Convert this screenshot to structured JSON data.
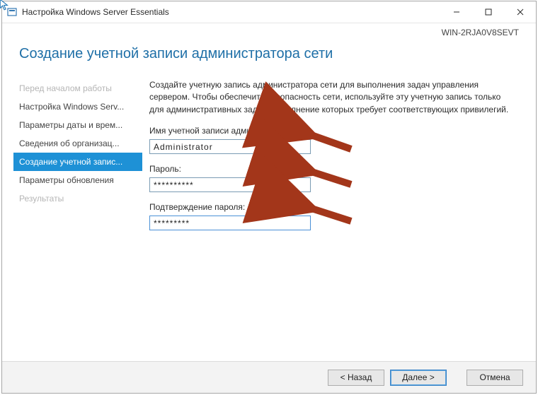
{
  "titlebar": {
    "title": "Настройка Windows Server Essentials"
  },
  "header": {
    "server_name": "WIN-2RJA0V8SEVT",
    "page_title": "Создание учетной записи администратора сети"
  },
  "sidebar": {
    "items": [
      {
        "label": "Перед началом работы",
        "state": "disabled"
      },
      {
        "label": "Настройка Windows Serv...",
        "state": "normal"
      },
      {
        "label": "Параметры даты и врем...",
        "state": "normal"
      },
      {
        "label": "Сведения об организац...",
        "state": "normal"
      },
      {
        "label": "Создание учетной запис...",
        "state": "selected"
      },
      {
        "label": "Параметры обновления",
        "state": "normal"
      },
      {
        "label": "Результаты",
        "state": "disabled"
      }
    ]
  },
  "main": {
    "description": "Создайте учетную запись администратора сети для выполнения задач управления сервером. Чтобы обеспечить безопасность сети, используйте эту учетную запись только для административных задач, выполнение которых требует соответствующих привилегий.",
    "username_label": "Имя учетной записи администратора:",
    "username_value": "Administrator",
    "password_label": "Пароль:",
    "password_value": "**********",
    "confirm_label": "Подтверждение пароля:",
    "confirm_value": "*********"
  },
  "footer": {
    "back": "< Назад",
    "next": "Далее >",
    "cancel": "Отмена"
  },
  "colors": {
    "accent": "#1e91d6",
    "arrow": "#a3361a"
  }
}
